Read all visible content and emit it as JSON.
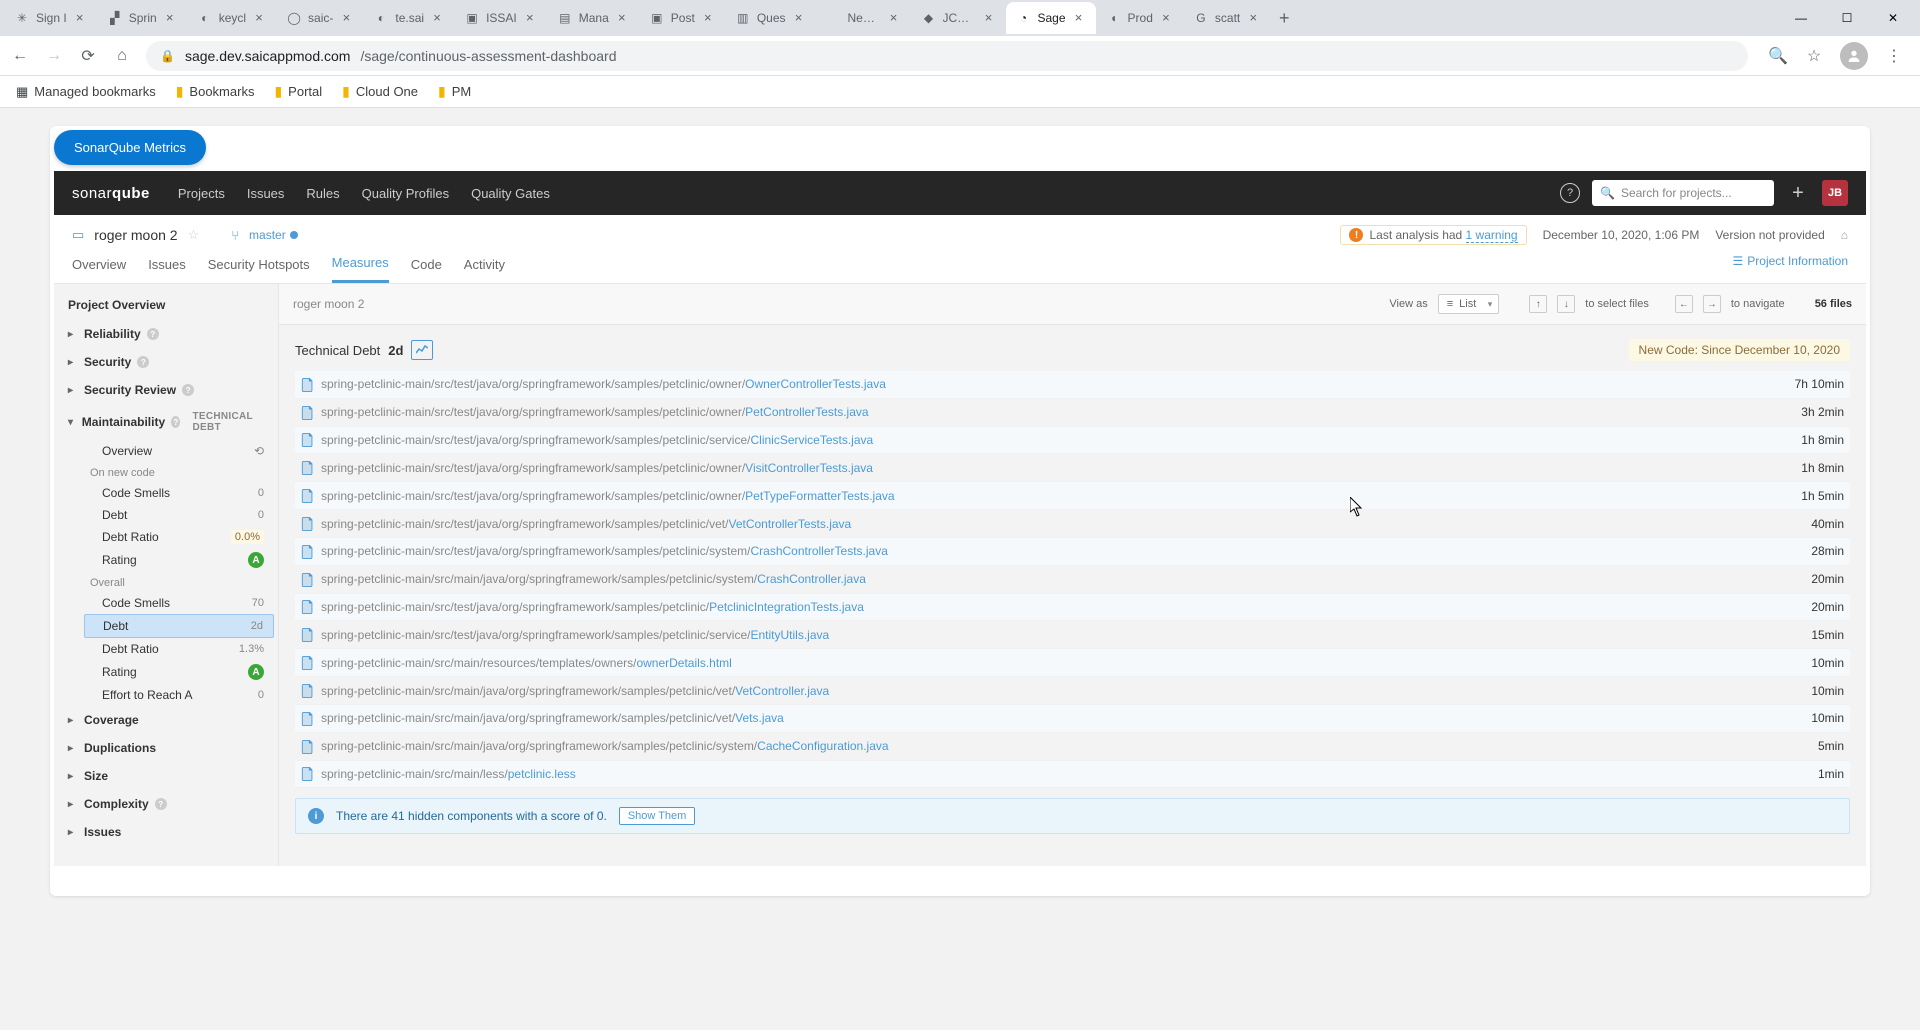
{
  "browser": {
    "tabs": [
      {
        "title": "Sign I",
        "fav": "✳"
      },
      {
        "title": "Sprin",
        "fav": "▞"
      },
      {
        "title": "keycl",
        "fav": "◐"
      },
      {
        "title": "saic-",
        "fav": "◯"
      },
      {
        "title": "te.sai",
        "fav": "◐"
      },
      {
        "title": "ISSAI",
        "fav": "▣"
      },
      {
        "title": "Mana",
        "fav": "▤"
      },
      {
        "title": "Post",
        "fav": "▣"
      },
      {
        "title": "Ques",
        "fav": "▥"
      },
      {
        "title": "New Tab",
        "fav": ""
      },
      {
        "title": "JCaaS",
        "fav": "◆"
      },
      {
        "title": "Sage",
        "fav": "◔",
        "active": true
      },
      {
        "title": "Prod",
        "fav": "◖"
      },
      {
        "title": "scatt",
        "fav": "G"
      }
    ],
    "url_host": "sage.dev.saicappmod.com",
    "url_path": "/sage/continuous-assessment-dashboard",
    "bookmarks": [
      "Managed bookmarks",
      "Bookmarks",
      "Portal",
      "Cloud One",
      "PM"
    ]
  },
  "page": {
    "pill_label": "SonarQube Metrics"
  },
  "sonar": {
    "logo_a": "sonar",
    "logo_b": "qube",
    "nav": [
      "Projects",
      "Issues",
      "Rules",
      "Quality Profiles",
      "Quality Gates"
    ],
    "search_placeholder": "Search for projects...",
    "user_initials": "JB",
    "project": {
      "name": "roger moon 2",
      "branch": "master",
      "warn_prefix": "Last analysis had ",
      "warn_link": "1 warning",
      "date": "December 10, 2020, 1:06 PM",
      "version": "Version not provided"
    },
    "tabs": [
      "Overview",
      "Issues",
      "Security Hotspots",
      "Measures",
      "Code",
      "Activity"
    ],
    "active_tab": "Measures",
    "project_info": "Project Information",
    "side": {
      "overview": "Project Overview",
      "cats": [
        {
          "name": "Reliability",
          "info": true
        },
        {
          "name": "Security",
          "info": true
        },
        {
          "name": "Security Review",
          "info": true
        }
      ],
      "maint": {
        "label": "Maintainability",
        "tag": "TECHNICAL DEBT",
        "overview_label": "Overview",
        "newcode_label": "On new code",
        "newcode_rows": [
          {
            "k": "Code Smells",
            "v": "0"
          },
          {
            "k": "Debt",
            "v": "0"
          },
          {
            "k": "Debt Ratio",
            "v": "0.0%",
            "pill": true
          },
          {
            "k": "Rating",
            "v": "A",
            "rating": true
          }
        ],
        "overall_label": "Overall",
        "overall_rows": [
          {
            "k": "Code Smells",
            "v": "70"
          },
          {
            "k": "Debt",
            "v": "2d",
            "selected": true
          },
          {
            "k": "Debt Ratio",
            "v": "1.3%"
          },
          {
            "k": "Rating",
            "v": "A",
            "rating": true
          },
          {
            "k": "Effort to Reach A",
            "v": "0"
          }
        ]
      },
      "rest": [
        "Coverage",
        "Duplications",
        "Size",
        "Complexity",
        "Issues"
      ],
      "rest_info": {
        "Complexity": true
      }
    },
    "main": {
      "crumb": "roger moon 2",
      "view_label": "View as",
      "view_value": "List",
      "select_hint": "to select files",
      "nav_hint": "to navigate",
      "file_count": "56 files",
      "debt_title": "Technical Debt",
      "debt_val": "2d",
      "new_code": "New Code: Since December 10, 2020",
      "files": [
        {
          "p": "spring-petclinic-main/src/test/java/org/springframework/samples/petclinic/owner/",
          "n": "OwnerControllerTests.java",
          "t": "7h 10min"
        },
        {
          "p": "spring-petclinic-main/src/test/java/org/springframework/samples/petclinic/owner/",
          "n": "PetControllerTests.java",
          "t": "3h 2min"
        },
        {
          "p": "spring-petclinic-main/src/test/java/org/springframework/samples/petclinic/service/",
          "n": "ClinicServiceTests.java",
          "t": "1h 8min"
        },
        {
          "p": "spring-petclinic-main/src/test/java/org/springframework/samples/petclinic/owner/",
          "n": "VisitControllerTests.java",
          "t": "1h 8min"
        },
        {
          "p": "spring-petclinic-main/src/test/java/org/springframework/samples/petclinic/owner/",
          "n": "PetTypeFormatterTests.java",
          "t": "1h 5min"
        },
        {
          "p": "spring-petclinic-main/src/test/java/org/springframework/samples/petclinic/vet/",
          "n": "VetControllerTests.java",
          "t": "40min"
        },
        {
          "p": "spring-petclinic-main/src/test/java/org/springframework/samples/petclinic/system/",
          "n": "CrashControllerTests.java",
          "t": "28min"
        },
        {
          "p": "spring-petclinic-main/src/main/java/org/springframework/samples/petclinic/system/",
          "n": "CrashController.java",
          "t": "20min"
        },
        {
          "p": "spring-petclinic-main/src/test/java/org/springframework/samples/petclinic/",
          "n": "PetclinicIntegrationTests.java",
          "t": "20min"
        },
        {
          "p": "spring-petclinic-main/src/test/java/org/springframework/samples/petclinic/service/",
          "n": "EntityUtils.java",
          "t": "15min"
        },
        {
          "p": "spring-petclinic-main/src/main/resources/templates/owners/",
          "n": "ownerDetails.html",
          "t": "10min"
        },
        {
          "p": "spring-petclinic-main/src/main/java/org/springframework/samples/petclinic/vet/",
          "n": "VetController.java",
          "t": "10min"
        },
        {
          "p": "spring-petclinic-main/src/main/java/org/springframework/samples/petclinic/vet/",
          "n": "Vets.java",
          "t": "10min"
        },
        {
          "p": "spring-petclinic-main/src/main/java/org/springframework/samples/petclinic/system/",
          "n": "CacheConfiguration.java",
          "t": "5min"
        },
        {
          "p": "spring-petclinic-main/src/main/less/",
          "n": "petclinic.less",
          "t": "1min"
        }
      ],
      "hidden_msg": "There are 41 hidden components with a score of 0.",
      "show_them": "Show Them"
    }
  }
}
